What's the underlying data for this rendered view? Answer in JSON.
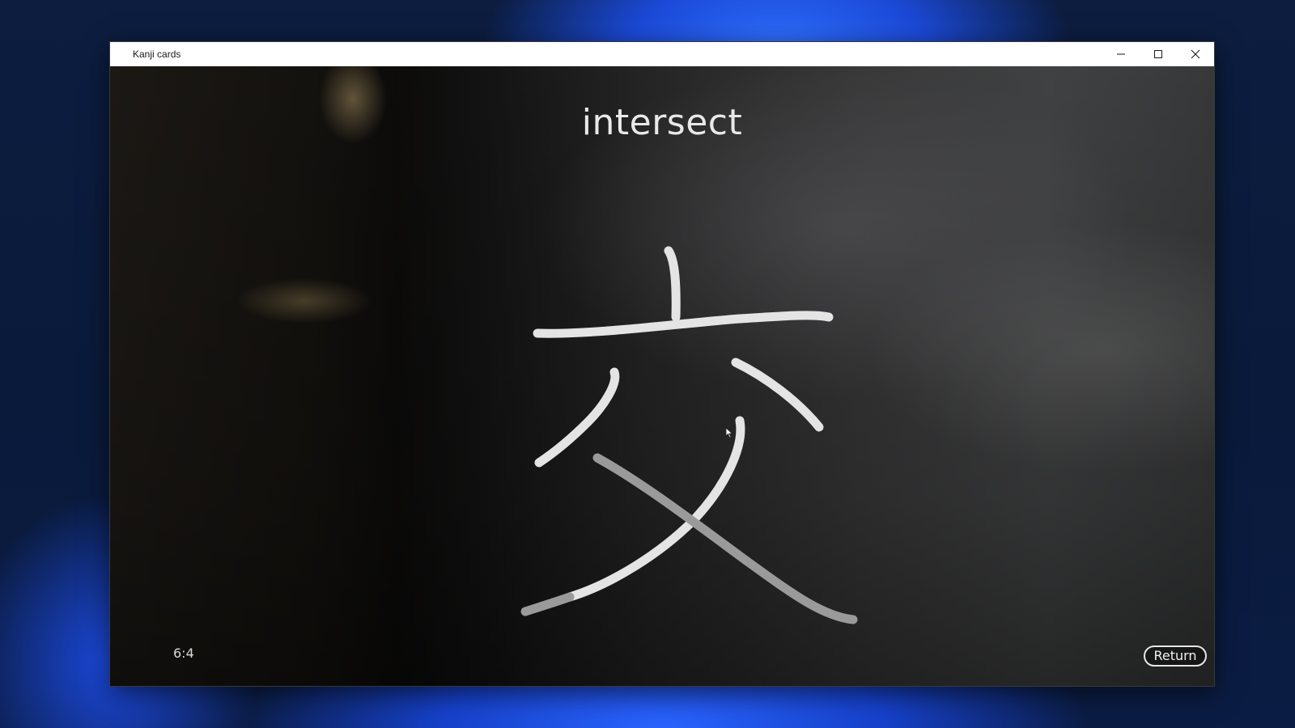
{
  "window": {
    "title": "Kanji cards"
  },
  "card": {
    "meaning": "intersect",
    "kanji": "交",
    "counter": "6:4"
  },
  "buttons": {
    "return_label": "Return"
  },
  "icons": {
    "minimize": "minimize-icon",
    "maximize": "maximize-icon",
    "close": "close-icon",
    "cursor": "mouse-cursor-icon"
  },
  "colors": {
    "stroke": "#e4e4e4",
    "stroke_faded": "#9a9a9a",
    "titlebar": "#ffffff"
  }
}
